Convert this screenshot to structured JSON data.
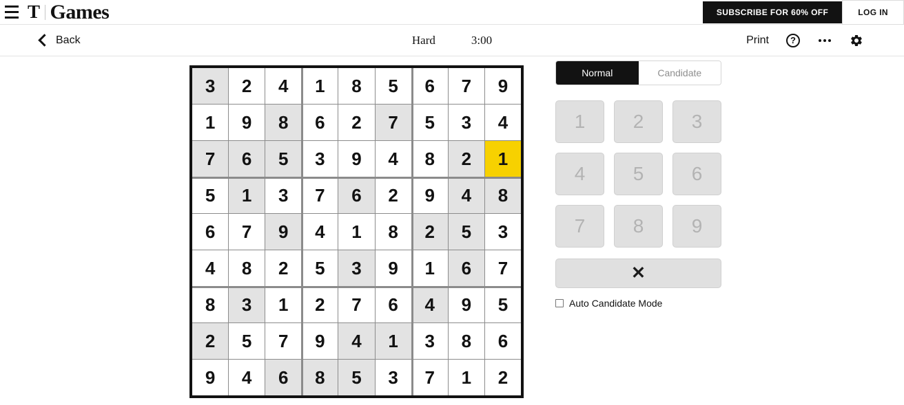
{
  "masthead": {
    "menu_icon": "hamburger-menu-icon",
    "logo_mark": "T",
    "section": "Games",
    "subscribe_label": "SUBSCRIBE FOR 60% OFF",
    "login_label": "LOG IN"
  },
  "toolbar": {
    "back_label": "Back",
    "back_icon": "chevron-left-icon",
    "difficulty": "Hard",
    "timer": "3:00",
    "print_label": "Print",
    "help_icon": "question-mark-circle-icon",
    "help_glyph": "?",
    "more_icon": "ellipsis-icon",
    "settings_icon": "gear-icon"
  },
  "board": {
    "rows": [
      [
        3,
        2,
        4,
        1,
        8,
        5,
        6,
        7,
        9
      ],
      [
        1,
        9,
        8,
        6,
        2,
        7,
        5,
        3,
        4
      ],
      [
        7,
        6,
        5,
        3,
        9,
        4,
        8,
        2,
        1
      ],
      [
        5,
        1,
        3,
        7,
        6,
        2,
        9,
        4,
        8
      ],
      [
        6,
        7,
        9,
        4,
        1,
        8,
        2,
        5,
        3
      ],
      [
        4,
        8,
        2,
        5,
        3,
        9,
        1,
        6,
        7
      ],
      [
        8,
        3,
        1,
        2,
        7,
        6,
        4,
        9,
        5
      ],
      [
        2,
        5,
        7,
        9,
        4,
        1,
        3,
        8,
        6
      ],
      [
        9,
        4,
        6,
        8,
        5,
        3,
        7,
        1,
        2
      ]
    ],
    "shaded": [
      [
        1,
        0,
        0,
        0,
        0,
        0,
        0,
        0,
        0
      ],
      [
        0,
        0,
        1,
        0,
        0,
        1,
        0,
        0,
        0
      ],
      [
        1,
        1,
        1,
        0,
        0,
        0,
        0,
        1,
        0
      ],
      [
        0,
        1,
        0,
        0,
        1,
        0,
        0,
        1,
        1
      ],
      [
        0,
        0,
        1,
        0,
        0,
        0,
        1,
        1,
        0
      ],
      [
        0,
        0,
        0,
        0,
        1,
        0,
        0,
        1,
        0
      ],
      [
        0,
        1,
        0,
        0,
        0,
        0,
        1,
        0,
        0
      ],
      [
        1,
        0,
        0,
        0,
        1,
        1,
        0,
        0,
        0
      ],
      [
        0,
        0,
        1,
        1,
        1,
        0,
        0,
        0,
        0
      ]
    ],
    "selected": {
      "row": 2,
      "col": 8
    },
    "selected_color": "#f7d100",
    "shaded_color": "#e3e3e3",
    "border_color": "#121212"
  },
  "panel": {
    "modes": [
      {
        "label": "Normal",
        "active": true
      },
      {
        "label": "Candidate",
        "active": false
      }
    ],
    "numbers": [
      "1",
      "2",
      "3",
      "4",
      "5",
      "6",
      "7",
      "8",
      "9"
    ],
    "erase_icon": "close-x-icon",
    "erase_glyph": "✕",
    "auto_candidate_label": "Auto Candidate Mode",
    "auto_candidate_checked": false
  }
}
